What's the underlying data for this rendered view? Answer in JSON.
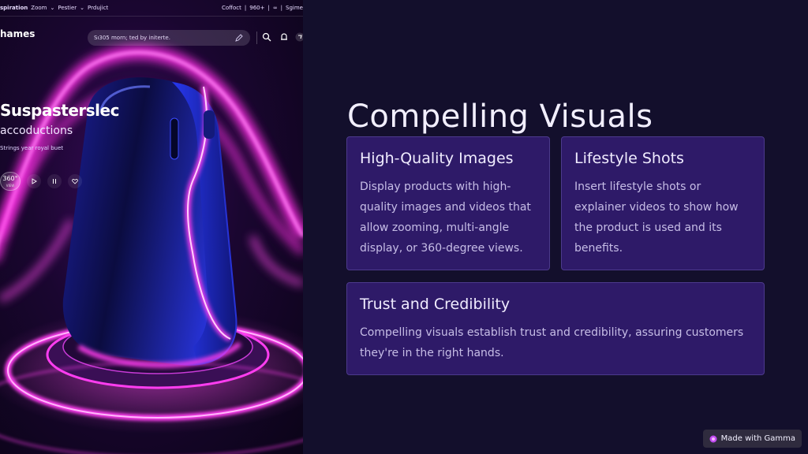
{
  "hero": {
    "nav_left": {
      "brand": "spiration",
      "items": [
        "Zoom",
        "Pestier",
        "Prdujict"
      ]
    },
    "nav_right": {
      "items": [
        "Coffoct",
        "960+",
        "Sgime"
      ]
    },
    "brand_name": "hames",
    "search_placeholder": "Sı305 morn; ted by initerte.",
    "headline": "Suspasterslec",
    "subheadline": "accoductions",
    "tagline": "Strings year royal buet",
    "view_badge": {
      "value": "360°",
      "label": "VIEW"
    },
    "icons": [
      "search-icon",
      "notification-icon",
      "cart-icon",
      "play-icon",
      "pause-icon",
      "heart-icon",
      "pencil-icon"
    ]
  },
  "slide": {
    "title": "Compelling Visuals",
    "cards": [
      {
        "heading": "High-Quality Images",
        "body": "Display products with high-quality images and videos that allow zooming, multi-angle display, or 360-degree views."
      },
      {
        "heading": "Lifestyle Shots",
        "body": "Insert lifestyle shots or explainer videos to show how the product is used and its benefits."
      },
      {
        "heading": "Trust and Credibility",
        "body": "Compelling visuals establish trust and credibility, assuring customers they're in the right hands."
      }
    ]
  },
  "badge": {
    "label": "Made with Gamma"
  },
  "colors": {
    "background": "#130f2c",
    "card": "#2e1a68",
    "card_border": "#4c3a8c",
    "neon_pink": "#ff3df0",
    "device_blue": "#2a3cff"
  }
}
